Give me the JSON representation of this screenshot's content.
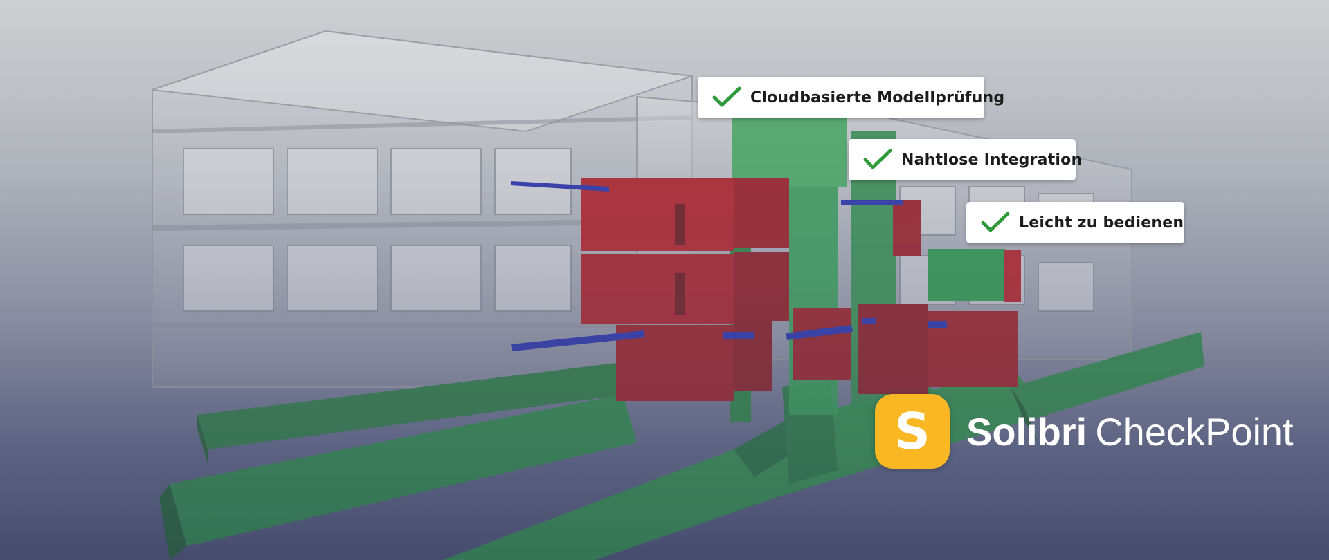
{
  "features": [
    {
      "label": "Cloudbasierte Modellprüfung"
    },
    {
      "label": "Nahtlose Integration"
    },
    {
      "label": "Leicht zu bedienen"
    }
  ],
  "logo": {
    "letter": "S",
    "brand": "Solibri",
    "product": "CheckPoint"
  },
  "colors": {
    "check": "#2f9a3a",
    "logo_badge": "#f9b823",
    "clash_red": "#9c1420",
    "element_green": "#1f7a3e",
    "pipe_blue": "#1a24a0"
  },
  "icons": {
    "feature_icon": "checkmark-icon"
  }
}
